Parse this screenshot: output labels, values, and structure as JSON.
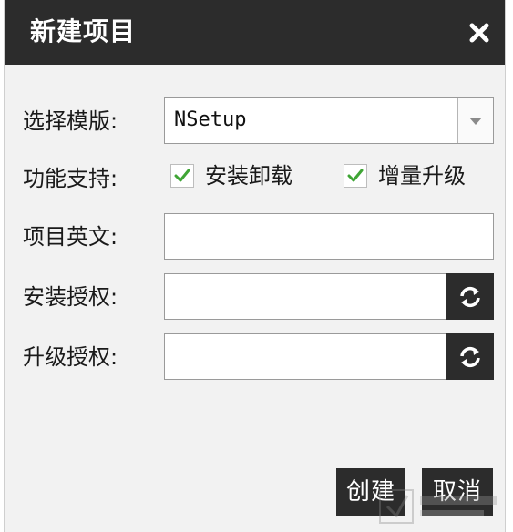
{
  "dialog": {
    "title": "新建项目",
    "close_icon": "close-icon"
  },
  "form": {
    "template_label": "选择模版:",
    "template_value": "NSetup",
    "features_label": "功能支持:",
    "feature_install": {
      "label": "安装卸载",
      "checked": true
    },
    "feature_upgrade": {
      "label": "增量升级",
      "checked": true
    },
    "project_en_label": "项目英文:",
    "project_en_value": "",
    "install_auth_label": "安装授权:",
    "install_auth_value": "",
    "upgrade_auth_label": "升级授权:",
    "upgrade_auth_value": ""
  },
  "buttons": {
    "create": "创建",
    "cancel": "取消"
  },
  "colors": {
    "titlebar": "#2c2c2c",
    "check_green": "#3fa535",
    "dialog_bg": "#f2f2f2"
  }
}
